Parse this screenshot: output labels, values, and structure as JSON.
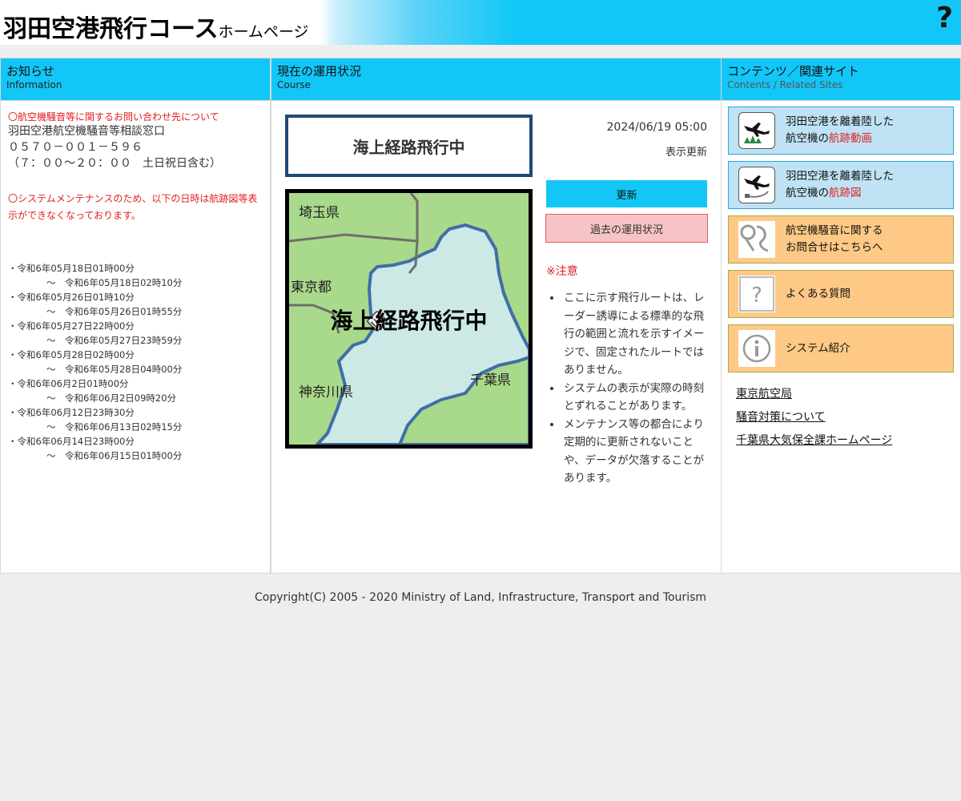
{
  "header": {
    "title_main": "羽田空港飛行コース",
    "title_sub": "ホームページ",
    "help_symbol": "?"
  },
  "info": {
    "heading_ja": "お知らせ",
    "heading_en": "Information",
    "notice1_title": "〇航空機騒音等に関するお問い合わせ先について",
    "notice1_lines": [
      "羽田空港航空機騒音等相談窓口",
      "０５７０－００１－５９６",
      "（７：００～２０：００　土日祝日含む）"
    ],
    "notice2": "〇システムメンテナンスのため、以下の日時は航跡図等表示ができなくなっております。",
    "schedule": [
      {
        "start": "・令和6年05月18日01時00分",
        "end": "～　令和6年05月18日02時10分"
      },
      {
        "start": "・令和6年05月26日01時10分",
        "end": "～　令和6年05月26日01時55分"
      },
      {
        "start": "・令和6年05月27日22時00分",
        "end": "～　令和6年05月27日23時59分"
      },
      {
        "start": "・令和6年05月28日02時00分",
        "end": "～　令和6年05月28日04時00分"
      },
      {
        "start": "・令和6年06月2日01時00分",
        "end": "～　令和6年06月2日09時20分"
      },
      {
        "start": "・令和6年06月12日23時30分",
        "end": "～　令和6年06月13日02時15分"
      },
      {
        "start": "・令和6年06月14日23時00分",
        "end": "～　令和6年06月15日01時00分"
      }
    ]
  },
  "course": {
    "heading_ja": "現在の運用状況",
    "heading_en": "Course",
    "status": "海上経路飛行中",
    "map": {
      "overlay": "海上経路飛行中",
      "labels": {
        "saitama": "埼玉県",
        "tokyo": "東京都",
        "kanagawa": "神奈川県",
        "chiba": "千葉県"
      },
      "land_color": "#a9d98a",
      "sea_color": "#cde9e6",
      "coast_color": "#3f6fa5"
    },
    "datetime": "2024/06/19 05:00",
    "display_update": "表示更新",
    "update_button": "更新",
    "past_button": "過去の運用状況",
    "caution_title": "※注意",
    "cautions": [
      "ここに示す飛行ルートは、レーダー誘導による標準的な飛行の範囲と流れを示すイメージで、固定されたルートではありません。",
      "システムの表示が実際の時刻とずれることがあります。",
      "メンテナンス等の都合により定期的に更新されないことや、データが欠落することがあります。"
    ]
  },
  "contents": {
    "heading_ja": "コンテンツ／関連サイト",
    "heading_en": "Contents / Related Sites",
    "menu": [
      {
        "line1": "羽田空港を離着陸した",
        "line2_pre": "航空機の",
        "line2_hl": "航跡動画",
        "icon": "airplane-forest-icon"
      },
      {
        "line1": "羽田空港を離着陸した",
        "line2_pre": "航空機の",
        "line2_hl": "航跡図",
        "icon": "airplane-track-icon"
      },
      {
        "line1": "航空機騒音に関する",
        "line2": "お問合せはこちらへ",
        "icon": "noise-inquiry-icon"
      },
      {
        "label": "よくある質問",
        "icon": "question-icon"
      },
      {
        "label": "システム紹介",
        "icon": "info-icon"
      }
    ],
    "links": [
      "東京航空局",
      "騒音対策について",
      "千葉県大気保全課ホームページ"
    ]
  },
  "footer": {
    "copyright": "Copyright(C) 2005 - 2020 Ministry of Land, Infrastructure, Transport and Tourism"
  }
}
